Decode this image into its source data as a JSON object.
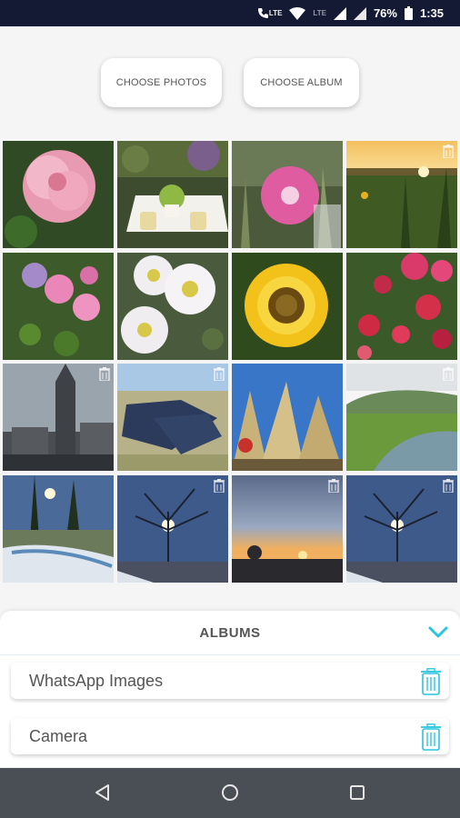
{
  "status_bar": {
    "lte_label_1": "LTE",
    "lte_label_2": "LTE",
    "battery": "76%",
    "time": "1:35",
    "icons": [
      "phone-icon",
      "wifi-icon",
      "signal-icon",
      "battery-icon"
    ]
  },
  "buttons": {
    "choose_photos": "CHOOSE PHOTOS",
    "choose_album": "CHOOSE ALBUM"
  },
  "photo_grid": {
    "rows": 4,
    "columns": 4,
    "tiles": [
      {
        "subject": "pink rose",
        "has_delete_icon": false
      },
      {
        "subject": "garden table with mugs",
        "has_delete_icon": false
      },
      {
        "subject": "pink mallow flower",
        "has_delete_icon": false
      },
      {
        "subject": "sunset over field",
        "has_delete_icon": true
      },
      {
        "subject": "pink wildflowers",
        "has_delete_icon": false
      },
      {
        "subject": "white anemones",
        "has_delete_icon": false
      },
      {
        "subject": "sunflower",
        "has_delete_icon": false
      },
      {
        "subject": "red fuchsia",
        "has_delete_icon": false
      },
      {
        "subject": "gothic town hall",
        "has_delete_icon": true
      },
      {
        "subject": "solar farm aerial",
        "has_delete_icon": true
      },
      {
        "subject": "wheat against sky",
        "has_delete_icon": false
      },
      {
        "subject": "green hills and lake",
        "has_delete_icon": true
      },
      {
        "subject": "snowy riverbank sunset",
        "has_delete_icon": false
      },
      {
        "subject": "tree with sun",
        "has_delete_icon": true
      },
      {
        "subject": "sunset horizon",
        "has_delete_icon": true
      },
      {
        "subject": "tree with sun",
        "has_delete_icon": true
      }
    ]
  },
  "albums": {
    "title": "ALBUMS",
    "items": [
      {
        "name": "WhatsApp Images"
      },
      {
        "name": "Camera"
      }
    ]
  },
  "nav_bar": {
    "icons": [
      "back-icon",
      "home-icon",
      "recents-icon"
    ]
  },
  "colors": {
    "status_bar_bg": "#141a33",
    "accent": "#29c4e0",
    "nav_bar_bg": "#4a4e55",
    "page_bg": "#f5f5f5"
  }
}
